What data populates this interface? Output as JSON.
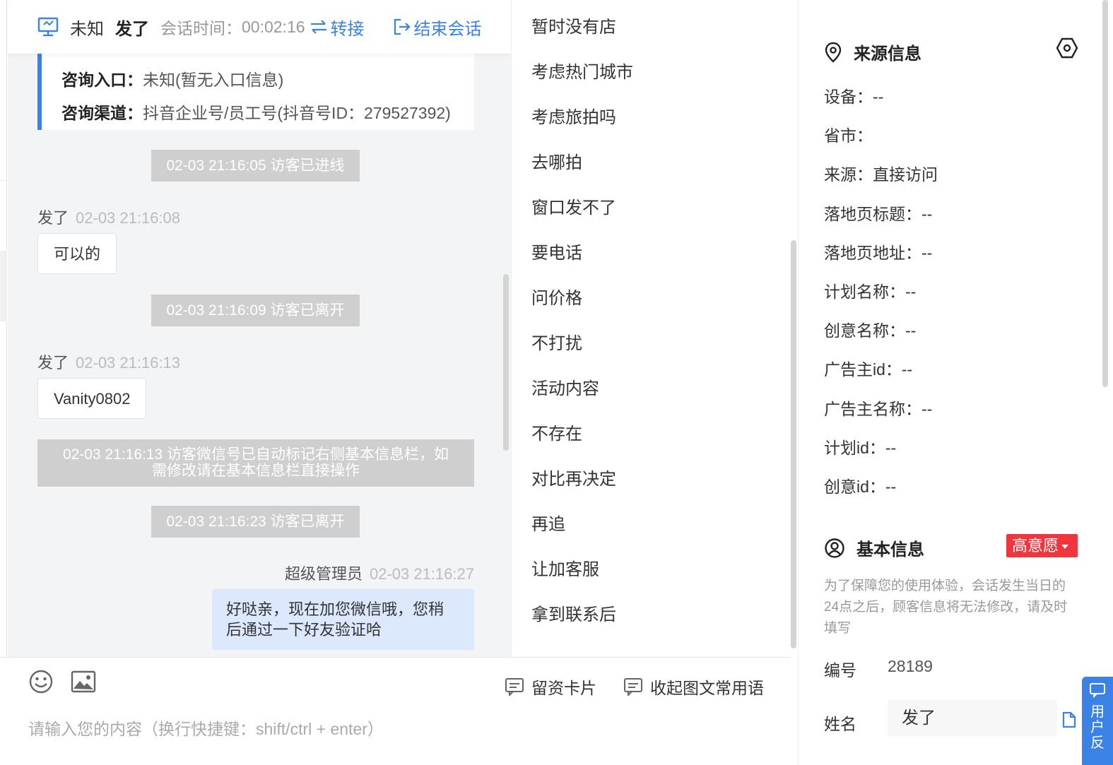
{
  "header": {
    "visitor_name": "未知",
    "nickname": "发了",
    "session_time_label": "会话时间：",
    "session_time": "00:02:16",
    "transfer_label": "转接",
    "end_label": "结束会话"
  },
  "entry": {
    "entry_key": "咨询入口：",
    "entry_value": "未知(暂无入口信息)",
    "channel_key": "咨询渠道：",
    "channel_value": "抖音企业号/员工号(抖音号ID：279527392)"
  },
  "messages": {
    "sys1": "02-03 21:16:05 访客已进线",
    "m1_name": "发了",
    "m1_time": "02-03 21:16:08",
    "m1_text": "可以的",
    "sys2": "02-03 21:16:09 访客已离开",
    "m2_name": "发了",
    "m2_time": "02-03 21:16:13",
    "m2_text": "Vanity0802",
    "sys3_line1": "02-03 21:16:13 访客微信号已自动标记右侧基本信息栏，如",
    "sys3_line2": "需修改请在基本信息栏直接操作",
    "sys4": "02-03 21:16:23 访客已离开",
    "agent_name": "超级管理员",
    "agent_time": "02-03 21:16:27",
    "agent_line1": "好哒亲，现在加您微信哦，您稍",
    "agent_line2": "后通过一下好友验证哈"
  },
  "composer": {
    "card_label": "留资卡片",
    "collapse_label": "收起图文常用语",
    "placeholder": "请输入您的内容（换行快捷键：shift/ctrl + enter）"
  },
  "phrases": [
    "暂时没有店",
    "考虑热门城市",
    "考虑旅拍吗",
    "去哪拍",
    "窗口发不了",
    "要电话",
    "问价格",
    "不打扰",
    "活动内容",
    "不存在",
    "对比再决定",
    "再追",
    "让加客服",
    "拿到联系后"
  ],
  "source": {
    "title": "来源信息",
    "rows": [
      "设备：--",
      "省市：",
      "来源：直接访问",
      "落地页标题：--",
      "落地页地址：--",
      "计划名称：--",
      "创意名称：--",
      "广告主id：--",
      "广告主名称：--",
      "计划id：--",
      "创意id：--"
    ]
  },
  "basic": {
    "title": "基本信息",
    "intent_badge": "高意愿",
    "notice": "为了保障您的使用体验，会话发生当日的24点之后，顾客信息将无法修改，请及时填写",
    "id_label": "编号",
    "id_value": "28189",
    "name_label": "姓名",
    "name_value": "发了"
  },
  "feedback": {
    "label": "用户反"
  },
  "colors": {
    "accent": "#3b82e6",
    "badge_red": "#f0353f",
    "system_grey": "#cfcfcf",
    "agent_bubble": "#dce8fb"
  }
}
